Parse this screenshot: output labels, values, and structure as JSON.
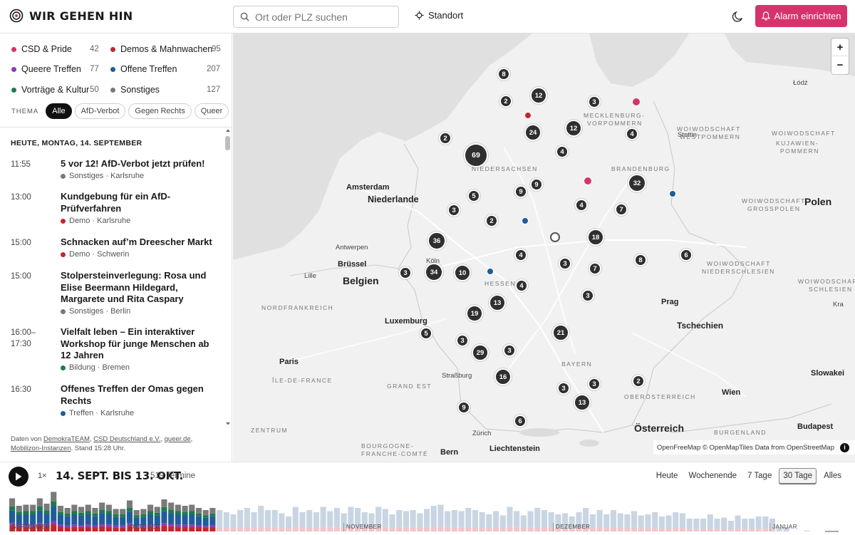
{
  "app": {
    "title": "WIR GEHEN HIN"
  },
  "header": {
    "search_placeholder": "Ort oder PLZ suchen",
    "standort_label": "Standort",
    "alarm_label": "Alarm einrichten"
  },
  "colors": {
    "accent": "#d6336c",
    "csd": "#d6336c",
    "demo": "#c0282e",
    "queer": "#8a3ab9",
    "offen": "#1f5c99",
    "bildung": "#1e7a4a",
    "sonstiges": "#7a7a7a"
  },
  "categories": [
    {
      "label": "CSD & Pride",
      "count": "42",
      "color": "#d6336c"
    },
    {
      "label": "Demos & Mahnwachen",
      "count": "95",
      "color": "#c0282e"
    },
    {
      "label": "Queere Treffen",
      "count": "77",
      "color": "#8a3ab9"
    },
    {
      "label": "Offene Treffen",
      "count": "207",
      "color": "#1f5c99"
    },
    {
      "label": "Vorträge & Kultur",
      "count": "50",
      "color": "#1e7a4a"
    },
    {
      "label": "Sonstiges",
      "count": "127",
      "color": "#7a7a7a"
    }
  ],
  "thema": {
    "label": "THEMA",
    "chips": [
      "Alle",
      "AfD-Verbot",
      "Gegen Rechts",
      "Queer"
    ]
  },
  "events": {
    "day_header": "HEUTE, MONTAG, 14. SEPTEMBER",
    "items": [
      {
        "time": "11:55",
        "title": "5 vor 12! AfD-Verbot jetzt prüfen!",
        "meta": "Sonstiges · Karlsruhe",
        "color": "#7a7a7a"
      },
      {
        "time": "13:00",
        "title": "Kundgebung für ein AfD-Prüfverfahren",
        "meta": "Demo · Karlsruhe",
        "color": "#c0282e"
      },
      {
        "time": "15:00",
        "title": "Schnacken auf’m Dreescher Markt",
        "meta": "Demo · Schwerin",
        "color": "#c0282e"
      },
      {
        "time": "15:00",
        "title": "Stolpersteinverlegung: Rosa und Elise Beermann Hildegard, Margarete und Rita Caspary",
        "meta": "Sonstiges · Berlin",
        "color": "#7a7a7a"
      },
      {
        "time": "16:00–17:30",
        "title": "Vielfalt leben – Ein interaktiver Workshop für junge Menschen ab 12 Jahren",
        "meta": "Bildung · Bremen",
        "color": "#1e7a4a"
      },
      {
        "time": "16:30",
        "title": "Offenes Treffen der Omas gegen Rechts",
        "meta": "Treffen · Karlsruhe",
        "color": "#1f5c99"
      }
    ]
  },
  "footer": {
    "prefix": "Daten von",
    "sources": [
      "DemokraTEAM",
      "CSD Deutschland e.V.",
      "queer.de",
      "Mobilizon-Instanzen"
    ],
    "stand": ". Stand 15:28 Uhr."
  },
  "map": {
    "attribution": "OpenFreeMap © OpenMapTiles Data from OpenStreetMap",
    "zoom_in": "+",
    "zoom_out": "−",
    "labels": {
      "amsterdam": "Amsterdam",
      "niederlande": "Niederlande",
      "antwerpen": "Antwerpen",
      "bruessel": "Brüssel",
      "belgien": "Belgien",
      "lille": "Lille",
      "luxemburg": "Luxemburg",
      "paris": "Paris",
      "koeln": "Köln",
      "strassburg": "Straßburg",
      "zuerich": "Zürich",
      "bern": "Bern",
      "liechtenstein": "Liechtenstein",
      "oesterreich": "Österreich",
      "wien": "Wien",
      "budapest": "Budapest",
      "prag": "Prag",
      "tschechien": "Tschechien",
      "polen": "Polen",
      "slowakei": "Slowakei",
      "krakau": "Krakau",
      "lodz": "Łódź",
      "stettin": "Stettin",
      "niedersachsen": "NIEDERSACHSEN",
      "brandenburg": "BRANDENBURG",
      "mecklenburg": "MECKLENBURG-",
      "vorpommern": "VORPOMMERN",
      "hessen": "HESSEN",
      "bayern": "BAYERN",
      "grand_est": "GRAND EST",
      "ile_de_france": "ÎLE-DE-FRANCE",
      "nordfrankreich": "NORDFRANKREICH",
      "zentrum": "ZENTRUM",
      "bourgogne": "BOURGOGNE-",
      "franche": "FRANCHE-COMTÉ",
      "oberoesterreich": "OBERÖSTERREICH",
      "burgenland": "BURGENLAND",
      "westpommern1": "WOIWODSCHAFT",
      "westpommern2": "WESTPOMMERN",
      "kujawien1": "WOIWODSCHAFT",
      "kujawien2": "KUJAWIEN-",
      "kujawien3": "POMMERN",
      "grosspolen1": "WOIWODSCHAFT",
      "grosspolen2": "GROSSPOLEN",
      "niederschlesien1": "WOIWODSCHAFT",
      "niederschlesien2": "NIEDERSCHLESIEN",
      "schlesien1": "WOIWODSCHAFT",
      "schlesien2": "SCHLESIEN",
      "kra": "Kra"
    },
    "clusters": [
      "8",
      "12",
      "2",
      "3",
      "2",
      "24",
      "12",
      "4",
      "69",
      "4",
      "32",
      "9",
      "9",
      "5",
      "3",
      "4",
      "7",
      "2",
      "36",
      "18",
      "6",
      "34",
      "10",
      "3",
      "4",
      "3",
      "7",
      "8",
      "4",
      "3",
      "19",
      "13",
      "21",
      "5",
      "3",
      "3",
      "29",
      "16",
      "2",
      "3",
      "3",
      "13",
      "9",
      "6"
    ]
  },
  "timeline": {
    "speed": "1×",
    "range": "14. SEPT. BIS 13. OKT.",
    "count": "519 Termine",
    "periods": [
      "Heute",
      "Wochenende",
      "7 Tage",
      "30 Tage",
      "Alles"
    ],
    "active_period": "30 Tage",
    "months": [
      "SEPTEMBER",
      "OKTOBER",
      "NOVEMBER",
      "DEZEMBER",
      "JANUAR"
    ],
    "daily_totals": [
      31,
      24,
      25,
      25,
      31,
      26,
      37,
      24,
      22,
      25,
      23,
      25,
      22,
      27,
      25,
      21,
      21,
      29,
      20,
      21,
      25,
      23,
      30,
      27,
      25,
      24,
      25,
      22,
      20,
      22,
      20,
      18,
      16,
      20,
      22,
      18,
      24,
      20,
      20,
      17,
      14,
      23,
      18,
      20,
      18,
      23,
      19,
      22,
      17,
      23,
      22,
      18,
      17,
      23,
      21,
      16,
      20,
      19,
      20,
      17,
      21,
      24,
      25,
      19,
      20,
      19,
      22,
      20,
      18,
      16,
      19,
      15,
      23,
      19,
      15,
      19,
      22,
      20,
      18,
      16,
      17,
      14,
      18,
      22,
      16,
      20,
      16,
      20,
      17,
      16,
      19,
      15,
      16,
      18,
      14,
      15,
      18,
      17,
      12,
      12,
      12,
      16,
      12,
      13,
      10,
      15,
      12,
      12,
      14,
      14,
      12,
      4,
      4,
      0,
      0,
      1,
      0
    ]
  }
}
